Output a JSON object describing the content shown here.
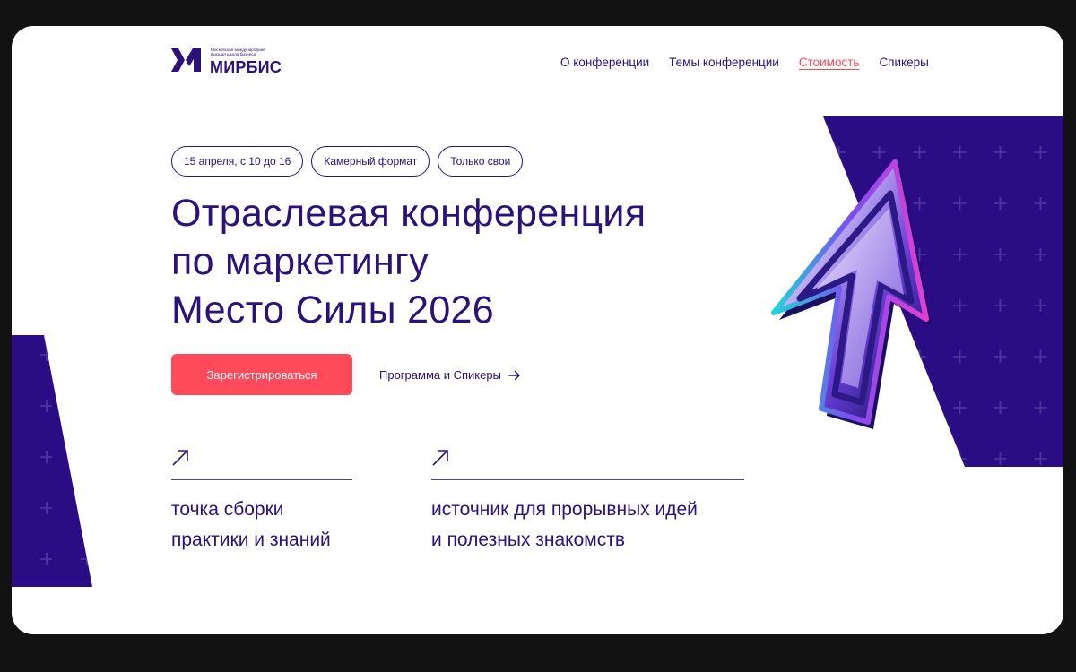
{
  "header": {
    "logo": {
      "subtitle_line1": "Московская международная",
      "subtitle_line2": "высшая школа бизнеса",
      "name": "МИРБИС"
    },
    "nav": [
      {
        "label": "О конференции",
        "active": false
      },
      {
        "label": "Темы конференции",
        "active": false
      },
      {
        "label": "Стоимость",
        "active": true
      },
      {
        "label": "Спикеры",
        "active": false
      }
    ]
  },
  "hero": {
    "tags": [
      "15 апреля, с 10 до 16",
      "Камерный формат",
      "Только свои"
    ],
    "title_lines": [
      "Отраслевая конференция",
      "по маркетингу",
      "Место Силы 2026"
    ],
    "cta_primary": "Зарегистрироваться",
    "cta_secondary": "Программа и Спикеры"
  },
  "features": [
    {
      "line1": "точка сборки",
      "line2": "практики и знаний"
    },
    {
      "line1": "источник для прорывных идей",
      "line2": "и полезных знакомств"
    }
  ],
  "icons": {
    "cta_secondary": "arrow-right-icon",
    "feature": "arrow-up-right-icon",
    "decoration": "cursor-pointer-icon"
  },
  "colors": {
    "brand": "#2a1278",
    "accent": "#ff4a5c",
    "page_bg": "#121212",
    "card_bg": "#ffffff"
  }
}
